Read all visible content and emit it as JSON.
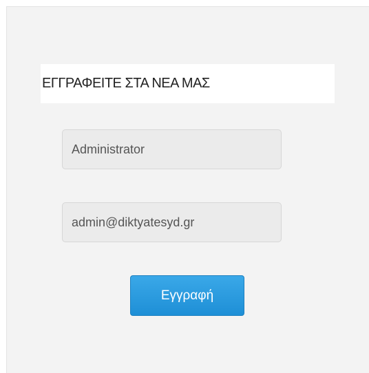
{
  "newsletter": {
    "heading": "ΕΓΓΡΑΦΕΙΤΕ ΣΤΑ ΝΕΑ ΜΑΣ",
    "name_value": "Administrator",
    "email_value": "admin@diktyatesyd.gr",
    "submit_label": "Εγγραφή"
  },
  "colors": {
    "panel_background": "#f3f3f3",
    "field_background": "#ebebeb",
    "button_accent": "#2b9be0"
  }
}
